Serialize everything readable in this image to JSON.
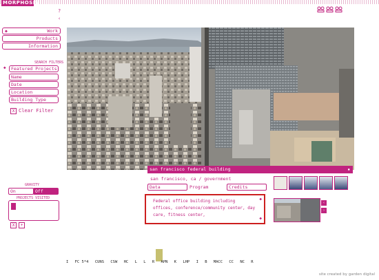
{
  "header": {
    "logo": "MORPHOSIS",
    "help": "?",
    "back": "‹",
    "icons": [
      "users-icon",
      "users-icon",
      "users-icon"
    ]
  },
  "nav": {
    "items": [
      {
        "label": "Work"
      },
      {
        "label": "Products"
      },
      {
        "label": "Information"
      }
    ]
  },
  "filters": {
    "title": "SEARCH FILTERS",
    "items": [
      {
        "label": "Featured Projects"
      },
      {
        "label": "Name"
      },
      {
        "label": "Date"
      },
      {
        "label": "Location"
      },
      {
        "label": "Building Type"
      }
    ],
    "clear": "Clear Filter",
    "clear_icon": "X"
  },
  "gravity": {
    "title": "GRAVITY",
    "on": "On",
    "off": "Off"
  },
  "visited": {
    "title": "PROJECTS VISITED",
    "btn1": "X",
    "btn2": "+"
  },
  "project": {
    "title": "san francisco federal building",
    "location": "san francisco, ca / government",
    "tabs": [
      "Data",
      "Program",
      "Credits"
    ],
    "description": "Federal office building including offices, conference/community center, day care, fitness center,"
  },
  "timeline": {
    "letters": [
      "I",
      "FC 5*4",
      "CUNS",
      "CSW",
      "HC",
      "L",
      "L",
      "R",
      "APN",
      "K",
      "LHP",
      "I",
      "B",
      "MACC",
      "CC",
      "NC",
      "R"
    ]
  },
  "footer": {
    "credit": "site created by garden digital"
  },
  "colors": {
    "accent": "#c0237f",
    "highlight": "#cc1e1e"
  }
}
